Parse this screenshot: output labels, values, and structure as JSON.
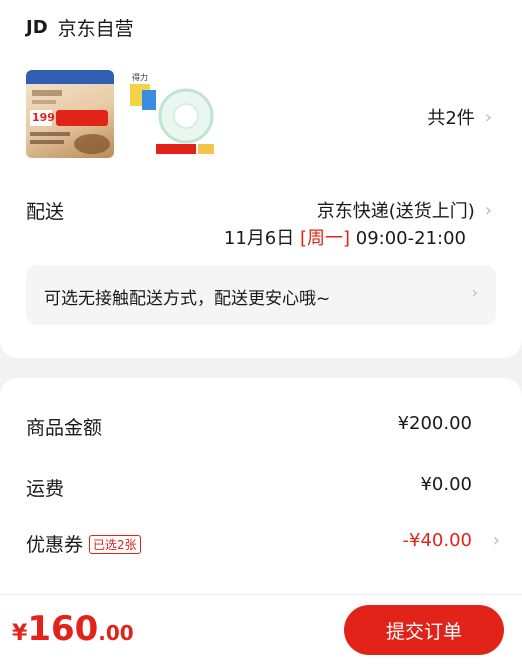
{
  "shop": {
    "logo": "JD",
    "name": "京东自营"
  },
  "items": {
    "count_label": "共2件",
    "thumb1_promo": "199",
    "thumb2_brand": "得力"
  },
  "delivery": {
    "label": "配送",
    "method": "京东快递(送货上门)",
    "date": "11月6日",
    "weekday": "[周一]",
    "time_range": "09:00-21:00",
    "notice": "可选无接触配送方式，配送更安心哦~"
  },
  "pricing": {
    "goods_label": "商品金额",
    "goods_value": "¥200.00",
    "shipping_label": "运费",
    "shipping_value": "¥0.00",
    "coupon_label": "优惠券",
    "coupon_badge": "已选2张",
    "coupon_value": "-¥40.00"
  },
  "footer": {
    "yen": "¥",
    "total_int": "160",
    "total_dec": ".00",
    "submit_label": "提交订单"
  },
  "colors": {
    "accent": "#e2231a",
    "background": "#f2f2f2"
  }
}
